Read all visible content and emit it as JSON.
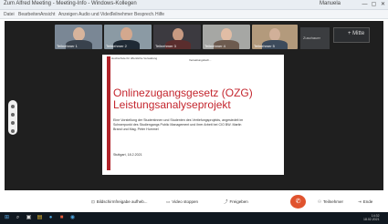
{
  "window": {
    "title": "Zum Alfred Meeting - Meeting-Info - Windows-Kollegen",
    "user_link": "Manuela",
    "controls": [
      "—",
      "▢",
      "✕"
    ]
  },
  "menu": {
    "items": [
      "Datei",
      "Bearbeiten",
      "Ansicht",
      "Anzeigen",
      "Audio und Video",
      "Teilnehmer",
      "Besprech.",
      "Hilfe"
    ]
  },
  "participants": [
    {
      "name": "Teilnehmer 1",
      "bg": "#7a8795",
      "skin": "#d7b49c"
    },
    {
      "name": "Teilnehmer 2",
      "bg": "#8b9aa4",
      "skin": "#d3a88e"
    },
    {
      "name": "Teilnehmer 3",
      "bg": "#3c3a40",
      "skin": "#c79a82"
    },
    {
      "name": "Teilnehmer 4",
      "bg": "#a6a7a4",
      "skin": "#e1bda5"
    },
    {
      "name": "Teilnehmer 5",
      "bg": "#b39a7c",
      "skin": "#d1b099"
    }
  ],
  "side_tile": {
    "label": "Zuschauer"
  },
  "avatar_box": {
    "label": "+ Mitte"
  },
  "slide": {
    "logo_a": "Hochschule für öffentliche Verwaltung",
    "logo_b": "Verwaltungsfach...",
    "title_line1": "Onlinezugangsgesetz (OZG)",
    "title_line2": "Leistungsanalyseprojekt",
    "description": "Eine Vorstellung der Studentinnen und Studenten des Vertiefungsprojekts, angesiedelt im Schwerpunkt des Studiengangs Public Management und ihrer Arbeit bei CIO BW. Martin Brand und Mag. Peter Hummel",
    "date": "Stuttgart, 18.2.2021"
  },
  "controls": {
    "recording_label": "Bildschirmfreigabe aufheb...",
    "video_label": "Video stoppen",
    "share_label": "Freigeben",
    "participants_label": "Teilnehmer",
    "end_label": "Ende",
    "hangup_glyph": "✆"
  },
  "taskbar": {
    "clock_time": "14:32",
    "clock_date": "18.02.2021"
  },
  "colors": {
    "accent_red": "#c4262e",
    "hangup": "#e0532e",
    "stage": "#1f1f1f"
  }
}
